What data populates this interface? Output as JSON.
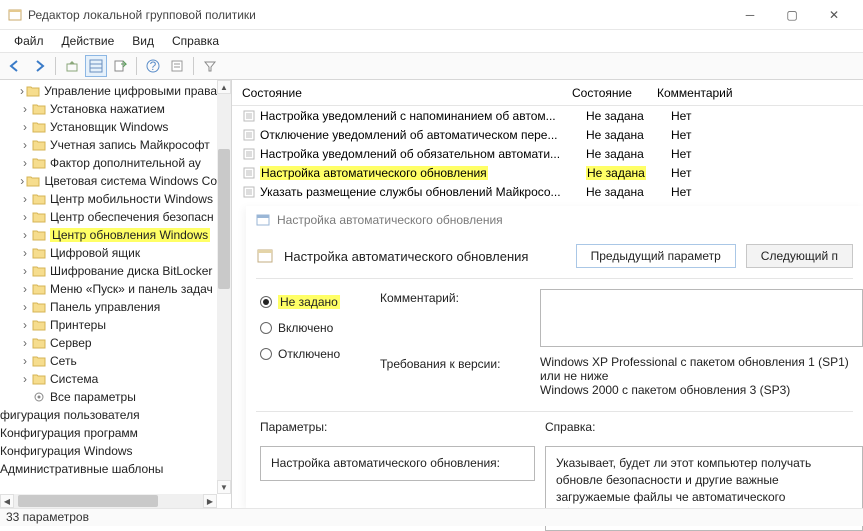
{
  "title": "Редактор локальной групповой политики",
  "menu": {
    "file": "Файл",
    "action": "Действие",
    "view": "Вид",
    "help": "Справка"
  },
  "tree": {
    "items": [
      {
        "label": "Управление цифровыми права",
        "hl": false
      },
      {
        "label": "Установка нажатием",
        "hl": false
      },
      {
        "label": "Установщик Windows",
        "hl": false
      },
      {
        "label": "Учетная запись Майкрософт",
        "hl": false
      },
      {
        "label": "Фактор дополнительной ау",
        "hl": false
      },
      {
        "label": "Цветовая система Windows Co",
        "hl": false
      },
      {
        "label": "Центр мобильности Windows",
        "hl": false
      },
      {
        "label": "Центр обеспечения безопасн",
        "hl": false
      },
      {
        "label": "Центр обновления Windows",
        "hl": true
      },
      {
        "label": "Цифровой ящик",
        "hl": false
      },
      {
        "label": "Шифрование диска BitLocker",
        "hl": false
      },
      {
        "label": "Меню «Пуск» и панель задач",
        "hl": false
      },
      {
        "label": "Панель управления",
        "hl": false
      },
      {
        "label": "Принтеры",
        "hl": false
      },
      {
        "label": "Сервер",
        "hl": false
      },
      {
        "label": "Сеть",
        "hl": false
      },
      {
        "label": "Система",
        "hl": false
      }
    ],
    "extra": [
      {
        "label": "Все параметры",
        "folder": false
      },
      {
        "label": "фигурация пользователя",
        "folder": false
      },
      {
        "label": "Конфигурация программ",
        "folder": false
      },
      {
        "label": "Конфигурация Windows",
        "folder": false
      },
      {
        "label": "Административные шаблоны",
        "folder": false
      }
    ]
  },
  "list": {
    "headers": {
      "c1": "Состояние",
      "c2": "Состояние",
      "c3": "Комментарий"
    },
    "rows": [
      {
        "c1": "Настройка уведомлений с напоминанием об автом...",
        "c2": "Не задана",
        "c3": "Нет",
        "hl": false
      },
      {
        "c1": "Отключение уведомлений об автоматическом пере...",
        "c2": "Не задана",
        "c3": "Нет",
        "hl": false
      },
      {
        "c1": "Настройка уведомлений об обязательном автомати...",
        "c2": "Не задана",
        "c3": "Нет",
        "hl": false
      },
      {
        "c1": "Настройка автоматического обновления",
        "c2": "Не задана",
        "c3": "Нет",
        "hl": true
      },
      {
        "c1": "Указать размещение службы обновлений Майкросо...",
        "c2": "Не задана",
        "c3": "Нет",
        "hl": false
      }
    ]
  },
  "dialog": {
    "title": "Настройка автоматического обновления",
    "header": "Настройка автоматического обновления",
    "prev": "Предыдущий параметр",
    "next": "Следующий п",
    "radios": {
      "r1": "Не задано",
      "r2": "Включено",
      "r3": "Отключено",
      "selected": 0
    },
    "commentLabel": "Комментарий:",
    "reqLabel": "Требования к версии:",
    "reqValue": "Windows XP Professional с пакетом обновления 1 (SP1) или не ниже\nWindows 2000 с пакетом обновления 3 (SP3)",
    "paramsLabel": "Параметры:",
    "helpLabel": "Справка:",
    "paramBox": "Настройка автоматического обновления:",
    "helpBox": "Указывает, будет ли этот компьютер получать обновле безопасности и другие важные загружаемые файлы че автоматического обновления Windows."
  },
  "status": "33 параметров"
}
